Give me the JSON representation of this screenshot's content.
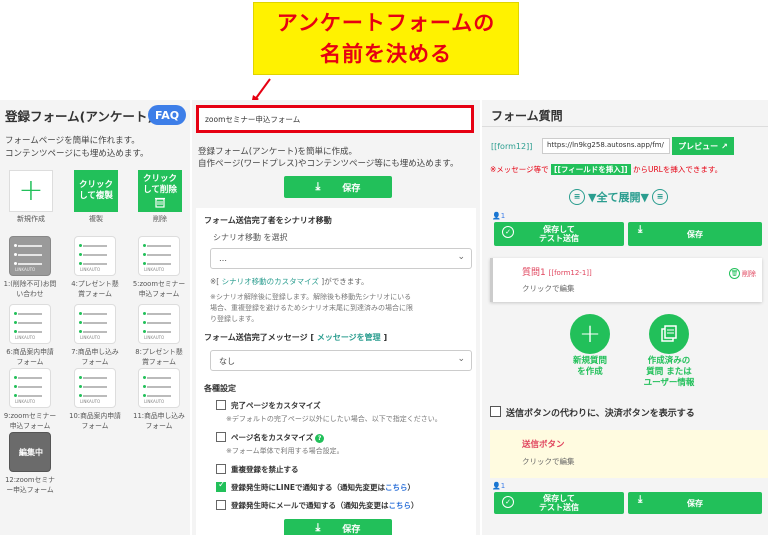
{
  "callout": {
    "line1": "アンケートフォームの",
    "line2": "名前を決める"
  },
  "left": {
    "title": "登録フォーム(アンケート)",
    "faq": "FAQ",
    "desc_line1": "フォームページを簡単に作れます。",
    "desc_line2": "コンテンツページにも埋め込めます。",
    "tools": {
      "new_label": "新規作成",
      "copy_text1": "クリック",
      "copy_text2": "して複製",
      "copy_label": "複製",
      "del_text1": "クリック",
      "del_text2": "して削除",
      "del_label": "削除"
    },
    "tile_label": "LINKAUTO",
    "editing_label": "編集中",
    "forms": [
      {
        "l1": "1:(削除不可)お問",
        "l2": "い合わせ"
      },
      {
        "l1": "4:プレゼント懸",
        "l2": "賞フォーム"
      },
      {
        "l1": "5:zoomセミナー",
        "l2": "申込フォーム"
      },
      {
        "l1": "6:商品案内申請",
        "l2": "フォーム"
      },
      {
        "l1": "7:商品申し込み",
        "l2": "フォーム"
      },
      {
        "l1": "8:プレゼント懸",
        "l2": "賞フォーム"
      },
      {
        "l1": "9:zoomセミナー",
        "l2": "申込フォーム"
      },
      {
        "l1": "10:商品案内申請",
        "l2": "フォーム"
      },
      {
        "l1": "11:商品申し込み",
        "l2": "フォーム"
      },
      {
        "l1": "12:zoomセミナ",
        "l2": "ー申込フォーム"
      }
    ]
  },
  "mid": {
    "form_name": "zoomセミナー申込フォーム",
    "desc_line1": "登録フォーム(アンケート)を簡単に作成。",
    "desc_line2": "自作ページ(ワードプレス)やコンテンツページ等にも埋め込めます。",
    "save": "保存",
    "scenario_title": "フォーム送信完了者をシナリオ移動",
    "scenario_sub": "シナリオ移動 を選択",
    "scenario_value": "…",
    "scenario_note_pre": "※[ ",
    "scenario_note_link": "シナリオ移動のカスタマイズ",
    "scenario_note_post": " ]ができます。",
    "scenario_warn1": "※シナリオ解除後に登録します。解除後も移動先シナリオにいる",
    "scenario_warn2": "場合、重複登録を避けるためシナリオ末尾に到達済みの場合に限",
    "scenario_warn3": "り登録します。",
    "msg_title": "フォーム送信完了メッセージ [ ",
    "msg_link": "メッセージを管理",
    "msg_title_post": " ]",
    "msg_value": "なし",
    "settings_title": "各種設定",
    "opt1": "完了ページをカスタマイズ",
    "opt1_note": "※デフォルトの完了ページ以外にしたい場合、以下で指定ください。",
    "opt2": "ページ名をカスタマイズ",
    "opt2_note": "※フォーム単体で利用する場合設定。",
    "opt3": "重複登録を禁止する",
    "opt4_pre": "登録発生時にLINEで通知する（通知先変更は",
    "opt4_link": "こちら",
    "opt4_post": "）",
    "opt5_pre": "登録発生時にメールで通知する（通知先変更は",
    "opt5_link": "こちら",
    "opt5_post": "）",
    "save_bottom": "保存"
  },
  "right": {
    "title": "フォーム質問",
    "tag": "[[form12]]",
    "url": "https://ln9kg258.autosns.app/fm/",
    "preview": "プレビュー",
    "msg_pre": "※メッセージ等で",
    "msg_insert": "[[フィールドを挿入]]",
    "msg_post": "からURLを挿入できます。",
    "expand": "▼全て展開▼",
    "count": "1",
    "save_test1": "保存して",
    "save_test2": "テスト送信",
    "save": "保存",
    "q_title": "質問1",
    "q_tag": "[[form12-1]]",
    "q_sub": "クリックで編集",
    "q_del": "削除",
    "new_q1": "新規質問",
    "new_q2": "を作成",
    "existing1": "作成済みの",
    "existing2": "質問 または",
    "existing3": "ユーザー情報",
    "pay_label": "送信ボタンの代わりに、決済ボタンを表示する",
    "send_title": "送信ボタン",
    "send_sub": "クリックで編集",
    "count2": "1"
  }
}
